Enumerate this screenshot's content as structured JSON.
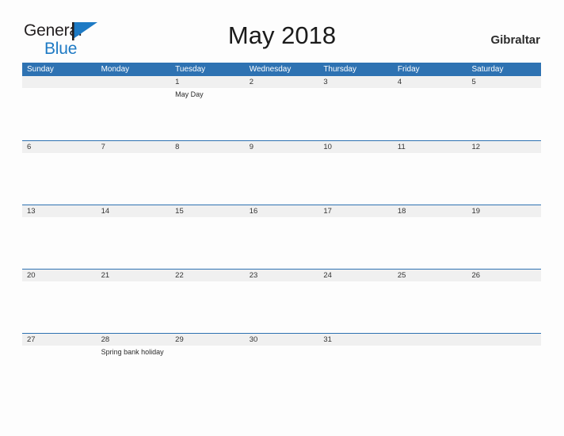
{
  "brand": {
    "name_top": "General",
    "name_bottom": "Blue",
    "flag_color": "#1e7ac4",
    "top_color": "#231f20",
    "bottom_color": "#1e7ac4"
  },
  "header": {
    "title": "May 2018",
    "region": "Gibraltar"
  },
  "colors": {
    "header_blue": "#2e72b2",
    "row_line_blue": "#2e72b2",
    "band_gray": "#f0f0f0",
    "page_background": "#fdfdfd"
  },
  "calendar": {
    "weekdays": [
      "Sunday",
      "Monday",
      "Tuesday",
      "Wednesday",
      "Thursday",
      "Friday",
      "Saturday"
    ],
    "weeks": [
      [
        {
          "date": "",
          "events": []
        },
        {
          "date": "",
          "events": []
        },
        {
          "date": "1",
          "events": [
            "May Day"
          ]
        },
        {
          "date": "2",
          "events": []
        },
        {
          "date": "3",
          "events": []
        },
        {
          "date": "4",
          "events": []
        },
        {
          "date": "5",
          "events": []
        }
      ],
      [
        {
          "date": "6",
          "events": []
        },
        {
          "date": "7",
          "events": []
        },
        {
          "date": "8",
          "events": []
        },
        {
          "date": "9",
          "events": []
        },
        {
          "date": "10",
          "events": []
        },
        {
          "date": "11",
          "events": []
        },
        {
          "date": "12",
          "events": []
        }
      ],
      [
        {
          "date": "13",
          "events": []
        },
        {
          "date": "14",
          "events": []
        },
        {
          "date": "15",
          "events": []
        },
        {
          "date": "16",
          "events": []
        },
        {
          "date": "17",
          "events": []
        },
        {
          "date": "18",
          "events": []
        },
        {
          "date": "19",
          "events": []
        }
      ],
      [
        {
          "date": "20",
          "events": []
        },
        {
          "date": "21",
          "events": []
        },
        {
          "date": "22",
          "events": []
        },
        {
          "date": "23",
          "events": []
        },
        {
          "date": "24",
          "events": []
        },
        {
          "date": "25",
          "events": []
        },
        {
          "date": "26",
          "events": []
        }
      ],
      [
        {
          "date": "27",
          "events": []
        },
        {
          "date": "28",
          "events": [
            "Spring bank holiday"
          ]
        },
        {
          "date": "29",
          "events": []
        },
        {
          "date": "30",
          "events": []
        },
        {
          "date": "31",
          "events": []
        },
        {
          "date": "",
          "events": []
        },
        {
          "date": "",
          "events": []
        }
      ]
    ]
  }
}
